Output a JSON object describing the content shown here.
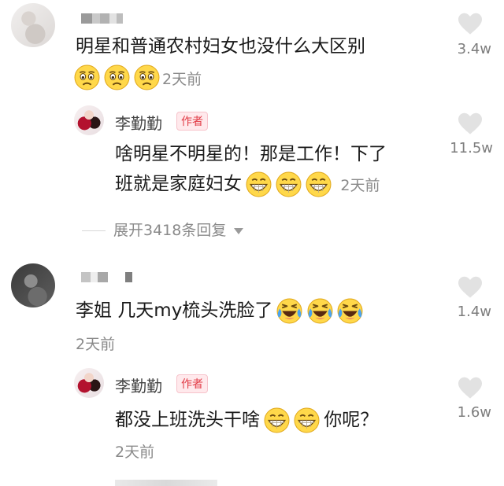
{
  "comments": [
    {
      "text": "明星和普通农村妇女也没什么大区别",
      "emojis": [
        "sad-face-icon",
        "sad-face-icon",
        "sad-face-icon"
      ],
      "time": "2天前",
      "likes": "3.4w",
      "reply": {
        "author": "李勤勤",
        "badge": "作者",
        "text_line1": "啥明星不明星的！那是工作！下了",
        "text_line2": "班就是家庭妇女",
        "emojis": [
          "grin-icon",
          "grin-icon",
          "grin-icon"
        ],
        "time": "2天前",
        "likes": "11.5w"
      },
      "expand": "展开3418条回复"
    },
    {
      "text": "李姐 几天my梳头洗脸了",
      "emojis": [
        "laugh-cry-icon",
        "laugh-cry-icon",
        "laugh-cry-icon"
      ],
      "time": "2天前",
      "likes": "1.4w",
      "reply": {
        "author": "李勤勤",
        "badge": "作者",
        "text_a": "都没上班洗头干啥",
        "text_b": "你呢？",
        "emojis": [
          "grin-icon",
          "grin-icon"
        ],
        "time": "2天前",
        "likes": "1.6w"
      }
    }
  ],
  "colors": {
    "badge": "#e13a45",
    "badge_bg": "#ffe9ec",
    "meta": "#8a8a8a",
    "heart": "#e2e2e2"
  }
}
